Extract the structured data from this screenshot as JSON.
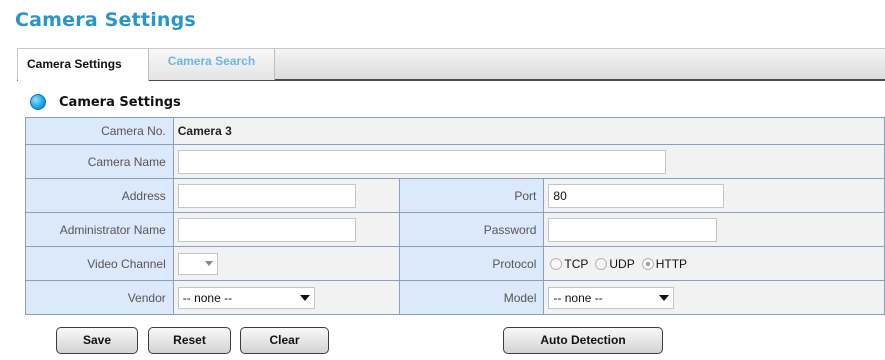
{
  "page": {
    "title": "Camera Settings"
  },
  "tabs": [
    {
      "label": "Camera Settings",
      "active": true
    },
    {
      "label": "Camera Search",
      "active": false
    }
  ],
  "section": {
    "title": "Camera Settings"
  },
  "form": {
    "camera_no": {
      "label": "Camera No.",
      "value": "Camera 3"
    },
    "camera_name": {
      "label": "Camera Name",
      "value": ""
    },
    "address": {
      "label": "Address",
      "value": ""
    },
    "port": {
      "label": "Port",
      "value": "80"
    },
    "admin_name": {
      "label": "Administrator Name",
      "value": ""
    },
    "password": {
      "label": "Password",
      "value": ""
    },
    "video_channel": {
      "label": "Video Channel",
      "value": ""
    },
    "protocol": {
      "label": "Protocol",
      "options": [
        "TCP",
        "UDP",
        "HTTP"
      ],
      "selected": "HTTP"
    },
    "vendor": {
      "label": "Vendor",
      "value": "-- none --"
    },
    "model": {
      "label": "Model",
      "value": "-- none --"
    }
  },
  "buttons": {
    "save": "Save",
    "reset": "Reset",
    "clear": "Clear",
    "auto_detection": "Auto Detection"
  },
  "colors": {
    "title_blue": "#2a94cc",
    "tab_inactive_text": "#6ab6e6",
    "label_cell_bg": "#dbe9fa",
    "value_cell_bg": "#f2f2f2",
    "grid_border": "#8a9fbd"
  }
}
